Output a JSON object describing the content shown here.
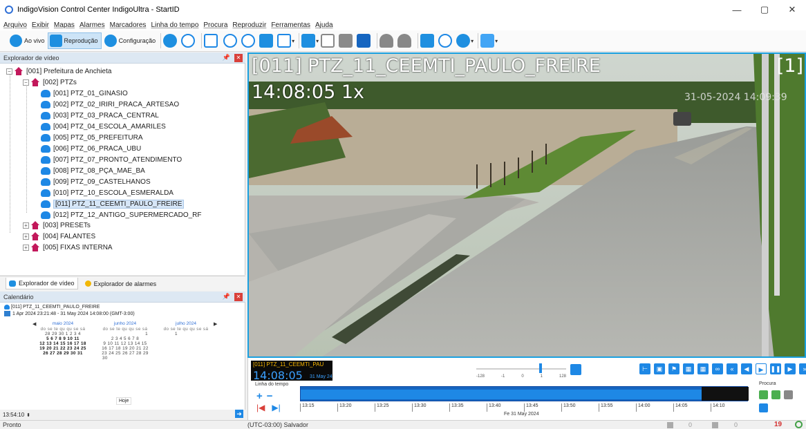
{
  "window": {
    "title": "IndigoVision Control Center IndigoUltra - StartID",
    "controls": [
      "—",
      "▢",
      "✕"
    ]
  },
  "menu": [
    "Arquivo",
    "Exibir",
    "Mapas",
    "Alarmes",
    "Marcadores",
    "Linha do tempo",
    "Procura",
    "Reproduzir",
    "Ferramentas",
    "Ajuda"
  ],
  "toolbar": {
    "live_label": "Ao vivo",
    "playback_label": "Reprodução",
    "config_label": "Configuração"
  },
  "video_explorer": {
    "title": "Explorador de vídeo",
    "root": "[001] Prefeitura de Anchieta",
    "group": "[002] PTZs",
    "cameras": [
      "[001] PTZ_01_GINASIO",
      "[002] PTZ_02_IRIRI_PRACA_ARTESAO",
      "[003] PTZ_03_PRACA_CENTRAL",
      "[004] PTZ_04_ESCOLA_AMARILES",
      "[005] PTZ_05_PREFEITURA",
      "[006] PTZ_06_PRACA_UBU",
      "[007] PTZ_07_PRONTO_ATENDIMENTO",
      "[008] PTZ_08_PÇA_MAE_BA",
      "[009] PTZ_09_CASTELHANOS",
      "[010] PTZ_10_ESCOLA_ESMERALDA",
      "[011] PTZ_11_CEEMTI_PAULO_FREIRE",
      "[012] PTZ_12_ANTIGO_SUPERMERCADO_RF"
    ],
    "selected_index": 10,
    "other_groups": [
      "[003] PRESETs",
      "[004] FALANTES",
      "[005] FIXAS INTERNA"
    ]
  },
  "tabs": {
    "video": "Explorador de vídeo",
    "alarms": "Explorador de alarmes"
  },
  "calendar": {
    "title": "Calendário",
    "camera": "[011] PTZ_11_CEEMTI_PAULO_FREIRE",
    "range": "1 Apr 2024 23:21:48 - 31 May 2024 14:08:00 (GMT-3:00)",
    "weekdays": "do se te qu qu se sá",
    "months": [
      {
        "name": "maio 2024",
        "rows": [
          "28 29 30 1 2 3 4",
          "5 6 7 8 9 10 11",
          "12 13 14 15 16 17 18",
          "19 20 21 22 23 24 25",
          "26 27 28 29 30 31"
        ]
      },
      {
        "name": "junho 2024",
        "rows": [
          "1",
          "2 3 4 5 6 7 8",
          "9 10 11 12 13 14 15",
          "16 17 18 19 20 21 22",
          "23 24 25 26 27 28 29",
          "30"
        ]
      },
      {
        "name": "julho 2024",
        "rows": [
          "1"
        ]
      }
    ],
    "today_label": "Hoje",
    "time_value": "13:54:10"
  },
  "video": {
    "overlay_title": "[011] PTZ_11_CEEMTI_PAULO_FREIRE",
    "overlay_time": "14:08:05 1x",
    "overlay_index": "[1]",
    "camera_timestamp": "31-05-2024 14:09:39"
  },
  "controls": {
    "cam_label": "[011] PTZ_11_CEEMTI_PAU",
    "cam_time": "14:08:05",
    "cam_date": "31 May 24",
    "speed_ticks": [
      "-128",
      "-1",
      "0",
      "1",
      "128"
    ],
    "speed_position": 0.72,
    "timeline_label": "Linha do tempo",
    "timeline_ticks": [
      "13:15",
      "13:20",
      "13:25",
      "13:30",
      "13:35",
      "13:40",
      "13:45",
      "13:50",
      "13:55",
      "14:00",
      "14:05",
      "14:10"
    ],
    "timeline_date": "Fe 31 May 2024",
    "search_label": "Procura"
  },
  "status": {
    "left": "Pronto",
    "timezone": "(UTC-03:00) Salvador",
    "count_a": "0",
    "count_b": "0",
    "alarms": "19"
  }
}
